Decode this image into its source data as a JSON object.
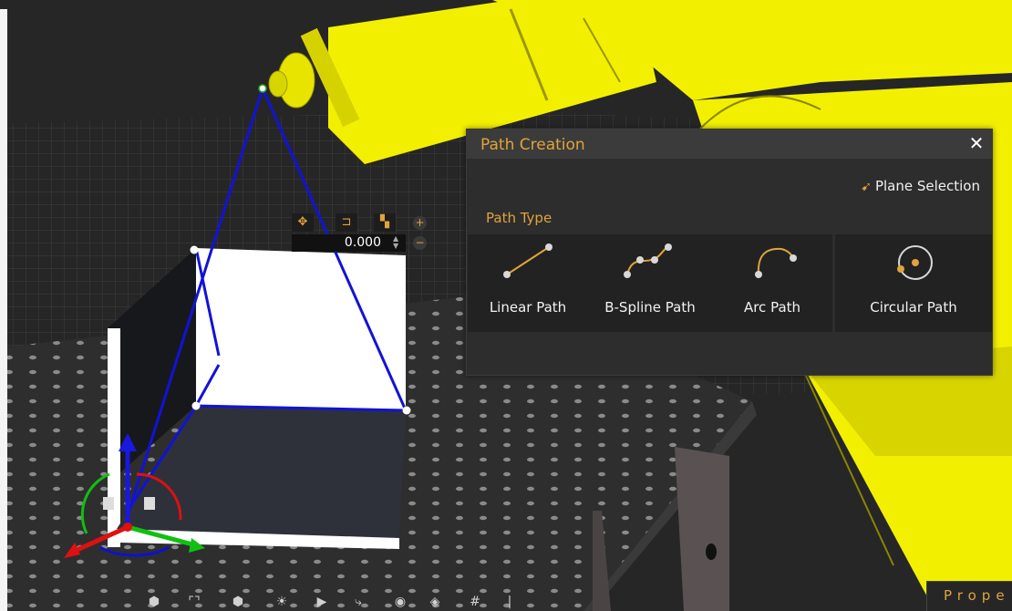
{
  "path_panel": {
    "title": "Path Creation",
    "close_icon": "close-icon",
    "plane_selection_label": "Plane Selection",
    "section_label": "Path Type",
    "path_types": [
      {
        "label": "Linear Path",
        "icon": "linear-path-icon"
      },
      {
        "label": "B-Spline Path",
        "icon": "bspline-path-icon"
      },
      {
        "label": "Arc Path",
        "icon": "arc-path-icon"
      },
      {
        "label": "Circular Path",
        "icon": "circular-path-icon"
      }
    ]
  },
  "gizmo": {
    "value": "0.000"
  },
  "properties_tab": {
    "label": "Prope"
  },
  "colors": {
    "accent": "#e2a33a",
    "robot": "#f2f000",
    "path_line": "#1010d8",
    "panel_bg": "#2d2d2d"
  }
}
